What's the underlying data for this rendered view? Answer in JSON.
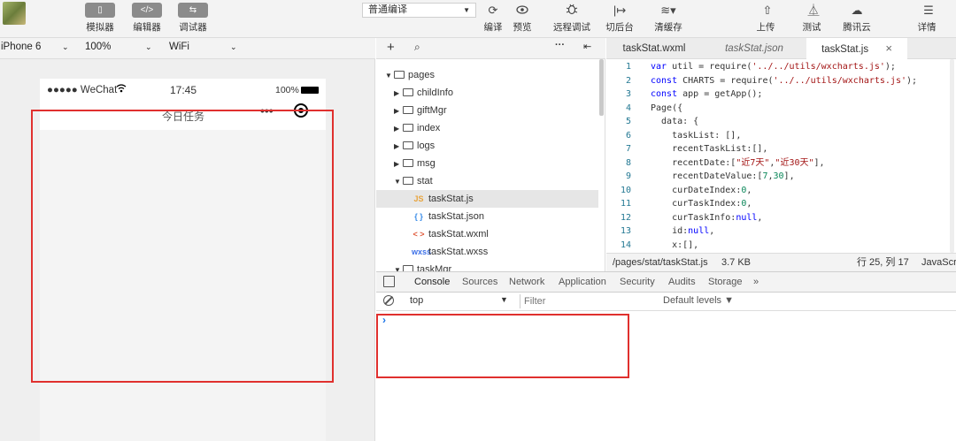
{
  "toolbar": {
    "simulator_label": "模拟器",
    "editor_label": "编辑器",
    "debugger_label": "调试器",
    "compile_mode": "普通编译",
    "compile_label": "编译",
    "preview_label": "预览",
    "remote_debug_label": "远程调试",
    "background_label": "切后台",
    "clear_cache_label": "清缓存",
    "upload_label": "上传",
    "test_label": "测试",
    "tencent_cloud_label": "腾讯云",
    "details_label": "详情",
    "simulator_icon": "▯",
    "editor_icon": "</>",
    "debugger_icon": "⇆",
    "background_icon": "|↦",
    "details_icon": "☰"
  },
  "device_bar": {
    "device": "iPhone 6",
    "zoom": "100%",
    "network": "WiFi"
  },
  "phone": {
    "carrier": "●●●●● WeChat",
    "time": "17:45",
    "battery": "100%",
    "page_title": "今日任务",
    "menu_dots": "•••"
  },
  "file_tree": {
    "items": [
      {
        "label": "pages",
        "type": "folder",
        "open": true
      },
      {
        "label": "childInfo",
        "type": "folder",
        "open": false
      },
      {
        "label": "giftMgr",
        "type": "folder",
        "open": false
      },
      {
        "label": "index",
        "type": "folder",
        "open": false
      },
      {
        "label": "logs",
        "type": "folder",
        "open": false
      },
      {
        "label": "msg",
        "type": "folder",
        "open": false
      },
      {
        "label": "stat",
        "type": "folder",
        "open": true
      },
      {
        "label": "taskStat.js",
        "type": "file",
        "icon_text": "JS",
        "icon_color": "#e8a33b"
      },
      {
        "label": "taskStat.json",
        "type": "file",
        "icon_text": "{ }",
        "icon_color": "#3b8de8"
      },
      {
        "label": "taskStat.wxml",
        "type": "file",
        "icon_text": "< >",
        "icon_color": "#e05a3b"
      },
      {
        "label": "taskStat.wxss",
        "type": "file",
        "icon_text": "wxss",
        "icon_color": "#3b6fe8"
      },
      {
        "label": "taskMgr",
        "type": "folder",
        "open": true
      }
    ]
  },
  "editor": {
    "tabs": [
      {
        "label": "taskStat.wxml"
      },
      {
        "label": "taskStat.json"
      },
      {
        "label": "taskStat.js"
      }
    ],
    "close_glyph": "×",
    "file_path": "/pages/stat/taskStat.js",
    "file_size": "3.7 KB",
    "cursor_position": "行 25, 列 17",
    "language": "JavaScript"
  },
  "code_lines": [
    "var util = require('../../utils/wxcharts.js');",
    "const CHARTS = require('../../utils/wxcharts.js');",
    "const app = getApp();",
    "Page({",
    "  data: {",
    "    taskList: [],",
    "    recentTaskList:[],",
    "    recentDate:[\"近7天\",\"近30天\"],",
    "    recentDateValue:[7,30],",
    "    curDateIndex:0,",
    "    curTaskIndex:0,",
    "    curTaskInfo:null,",
    "    id:null,",
    "    x:[],"
  ],
  "devtools": {
    "tabs": [
      "Console",
      "Sources",
      "Network",
      "Application",
      "Security",
      "Audits",
      "Storage"
    ],
    "more": "»",
    "context": "top",
    "filter_placeholder": "Filter",
    "levels": "Default levels ▼",
    "prompt": "›"
  },
  "highlight_color": "#e0302e"
}
